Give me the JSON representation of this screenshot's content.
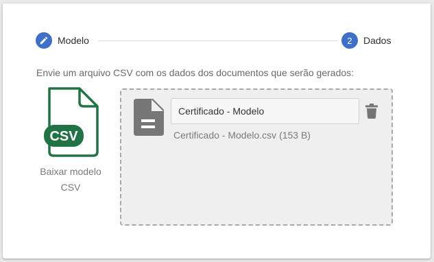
{
  "stepper": {
    "steps": [
      {
        "label": "Modelo",
        "icon": "pencil-icon",
        "state": "completed"
      },
      {
        "label": "Dados",
        "number": "2",
        "state": "active"
      }
    ],
    "accent_color": "#3d6fcb"
  },
  "instructions": "Envie um arquivo CSV com os dados dos documentos que serão gerados:",
  "template_download": {
    "badge": "CSV",
    "label": "Baixar modelo CSV",
    "icon": "csv-file-icon",
    "color": "#217346"
  },
  "upload": {
    "name_value": "Certificado - Modelo",
    "file_name": "Certificado - Modelo.csv",
    "file_size": "(153 B)",
    "file_icon": "document-icon",
    "delete_icon": "trash-icon"
  }
}
